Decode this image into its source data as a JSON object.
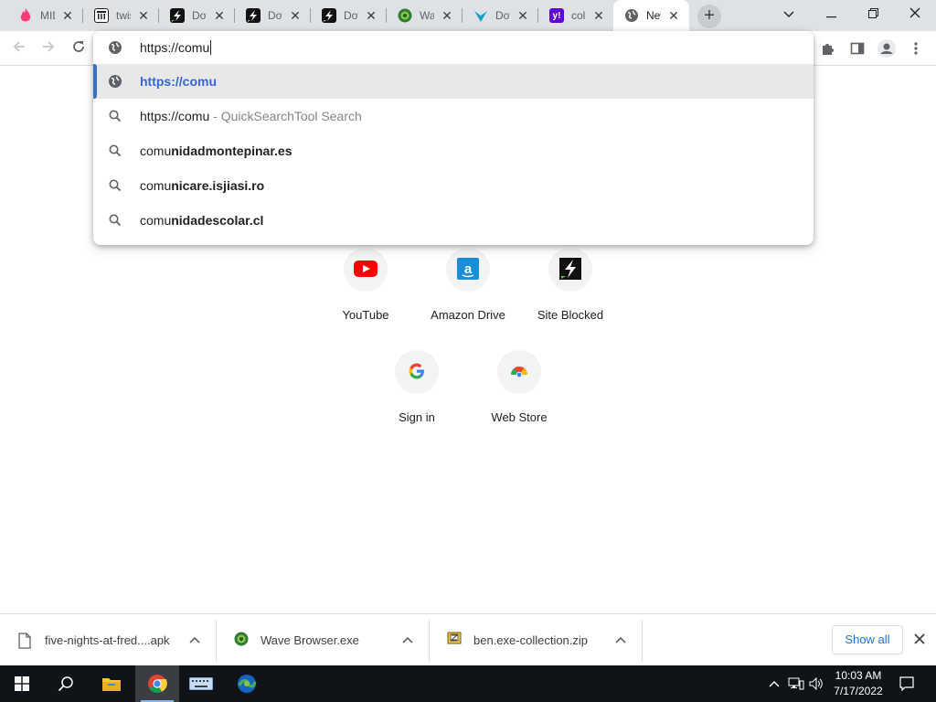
{
  "tabs": [
    {
      "title": "MID",
      "icon": "tinder-flame-icon",
      "color": "#fe3c72"
    },
    {
      "title": "twis",
      "icon": "library-columns-icon",
      "color": "#1f1f1f"
    },
    {
      "title": "Dov",
      "icon": "lightning-bolt-icon",
      "color": "#111111"
    },
    {
      "title": "Dov",
      "icon": "lightning-bolt-icon",
      "color": "#111111"
    },
    {
      "title": "Dov",
      "icon": "lightning-bolt-icon",
      "color": "#111111"
    },
    {
      "title": "Wav",
      "icon": "wave-browser-icon",
      "color": "#2e7d32"
    },
    {
      "title": "Dov",
      "icon": "download-arrow-icon",
      "color": "#1aa3c8"
    },
    {
      "title": "coll",
      "icon": "yahoo-icon",
      "color": "#6001d2"
    },
    {
      "title": "New",
      "icon": "globe-icon",
      "color": "#5f6368"
    }
  ],
  "omnibox": {
    "input_value": "https://comu",
    "suggestions": [
      {
        "icon": "globe-icon",
        "text": "https://comu",
        "selected": true
      },
      {
        "icon": "search-icon",
        "prefix": "https://comu",
        "suffix": " - QuickSearchTool Search"
      },
      {
        "icon": "search-icon",
        "prefix": "comu",
        "rest": "nidadmontepinar.es"
      },
      {
        "icon": "search-icon",
        "prefix": "comu",
        "rest": "nicare.isjiasi.ro"
      },
      {
        "icon": "search-icon",
        "prefix": "comu",
        "rest": "nidadescolar.cl"
      }
    ]
  },
  "shortcuts": {
    "row1": [
      {
        "label": "YouTube",
        "icon": "youtube-icon"
      },
      {
        "label": "Amazon Drive",
        "icon": "amazon-drive-icon"
      },
      {
        "label": "Site Blocked",
        "icon": "lightning-bolt-icon"
      }
    ],
    "row2": [
      {
        "label": "Sign in",
        "icon": "google-icon"
      },
      {
        "label": "Web Store",
        "icon": "chrome-web-store-icon"
      }
    ]
  },
  "downloads": {
    "items": [
      {
        "name": "five-nights-at-fred....apk",
        "icon": "file-icon"
      },
      {
        "name": "Wave Browser.exe",
        "icon": "wave-browser-icon"
      },
      {
        "name": "ben.exe-collection.zip",
        "icon": "zip-archive-icon"
      }
    ],
    "show_all_label": "Show all"
  },
  "taskbar": {
    "time": "10:03 AM",
    "date": "7/17/2022"
  },
  "colors": {
    "tabstrip_bg": "#dee1e6",
    "accent_blue": "#1a73e8",
    "selected_suggestion": "#3367d6",
    "taskbar_bg": "#101418"
  }
}
